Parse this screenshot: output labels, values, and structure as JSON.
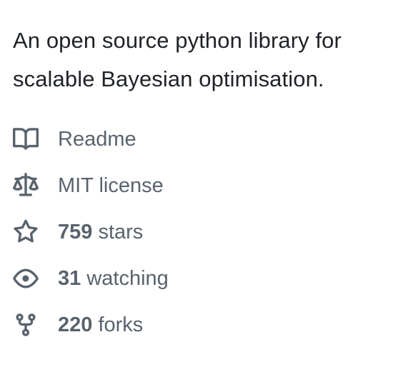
{
  "about": {
    "description": "An open source python library for scalable Bayesian optimisation."
  },
  "meta": {
    "readme": {
      "icon": "book-icon",
      "label": "Readme"
    },
    "license": {
      "icon": "law-icon",
      "label": "MIT license"
    },
    "stars": {
      "icon": "star-icon",
      "count": "759",
      "label": "stars"
    },
    "watching": {
      "icon": "eye-icon",
      "count": "31",
      "label": "watching"
    },
    "forks": {
      "icon": "repo-forked-icon",
      "count": "220",
      "label": "forks"
    }
  }
}
